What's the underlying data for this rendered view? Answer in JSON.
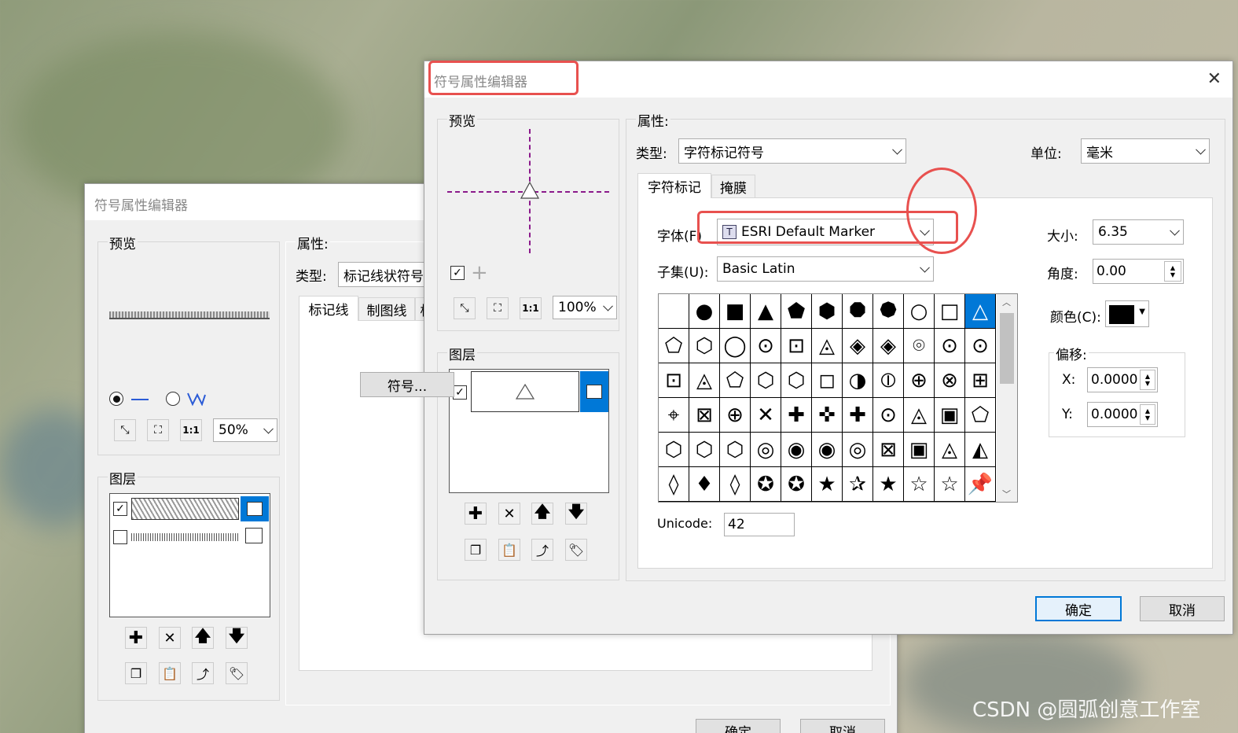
{
  "back_dialog": {
    "title": "符号属性编辑器",
    "preview_label": "预览",
    "properties_label": "属性:",
    "type_label": "类型:",
    "type_value": "标记线状符号",
    "tabs": [
      "标记线",
      "制图线",
      "标"
    ],
    "symbol_button": "符号...",
    "zoom_value": "50%",
    "layers_label": "图层",
    "ok_button": "确定",
    "cancel_button": "取消"
  },
  "dialog": {
    "title": "符号属性编辑器",
    "close_glyph": "✕",
    "preview_label": "预览",
    "zoom_value": "100%",
    "layers_label": "图层",
    "properties_label": "属性:",
    "type_label": "类型:",
    "type_value": "字符标记符号",
    "unit_label": "单位:",
    "unit_value": "毫米",
    "tabs": [
      "字符标记",
      "掩膜"
    ],
    "font_label": "字体(F)",
    "font_value": "ESRI Default Marker",
    "subset_label": "子集(U):",
    "subset_value": "Basic Latin",
    "size_label": "大小:",
    "size_value": "6.35",
    "angle_label": "角度:",
    "angle_value": "0.00",
    "color_label": "颜色(C):",
    "color_value": "#000000",
    "offset_label": "偏移:",
    "x_label": "X:",
    "x_value": "0.0000",
    "y_label": "Y:",
    "y_value": "0.0000",
    "unicode_label": "Unicode:",
    "unicode_value": "42",
    "ok_button": "确定",
    "cancel_button": "取消",
    "glyphs": [
      "",
      "●",
      "■",
      "▲",
      "⬟",
      "⬢",
      "⯃",
      "⯄",
      "○",
      "□",
      "△",
      "⬠",
      "⬡",
      "◯",
      "⊙",
      "⊡",
      "◬",
      "◈",
      "◈",
      "⌾",
      "⊙",
      "⊙",
      "⊡",
      "◬",
      "⬠",
      "⬡",
      "⬡",
      "◻",
      "◑",
      "⦶",
      "⊕",
      "⊗",
      "⊞",
      "⌖",
      "⊠",
      "⊕",
      "✕",
      "✚",
      "✜",
      "✚",
      "⊙",
      "◬",
      "▣",
      "⬠",
      "⬡",
      "⬡",
      "⬡",
      "◎",
      "◉",
      "◉",
      "◎",
      "⊠",
      "▣",
      "◬",
      "◭",
      "◊",
      "♦",
      "◊",
      "✪",
      "✪",
      "★",
      "✰",
      "★",
      "☆",
      "☆",
      "📌"
    ],
    "selected_index": 10
  },
  "colors": {
    "accent": "#0078d7",
    "highlight": "#e8514f",
    "preview_crosshair": "#8b1a8b"
  },
  "watermark": "CSDN @圆弧创意工作室"
}
